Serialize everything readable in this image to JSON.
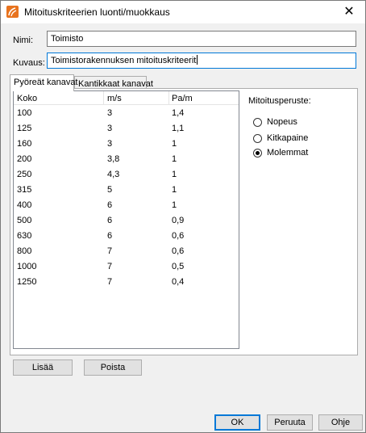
{
  "window": {
    "title": "Mitoituskriteerien luonti/muokkaus",
    "close_glyph": "✕"
  },
  "form": {
    "name_label": "Nimi:",
    "name_value": "Toimisto",
    "description_label": "Kuvaus:",
    "description_value": "Toimistorakennuksen mitoituskriteerit"
  },
  "tabs": [
    {
      "label": "Pyöreät kanavat",
      "active": true
    },
    {
      "label": "Kantikkaat kanavat",
      "active": false
    }
  ],
  "grid": {
    "columns": [
      "Koko",
      "m/s",
      "Pa/m"
    ],
    "rows": [
      [
        "100",
        "3",
        "1,4"
      ],
      [
        "125",
        "3",
        "1,1"
      ],
      [
        "160",
        "3",
        "1"
      ],
      [
        "200",
        "3,8",
        "1"
      ],
      [
        "250",
        "4,3",
        "1"
      ],
      [
        "315",
        "5",
        "1"
      ],
      [
        "400",
        "6",
        "1"
      ],
      [
        "500",
        "6",
        "0,9"
      ],
      [
        "630",
        "6",
        "0,6"
      ],
      [
        "800",
        "7",
        "0,6"
      ],
      [
        "1000",
        "7",
        "0,5"
      ],
      [
        "1250",
        "7",
        "0,4"
      ]
    ]
  },
  "sizing_basis": {
    "label": "Mitoitusperuste:",
    "options": [
      {
        "label": "Nopeus",
        "checked": false
      },
      {
        "label": "Kitkapaine",
        "checked": false
      },
      {
        "label": "Molemmat",
        "checked": true
      }
    ]
  },
  "buttons": {
    "add": "Lisää",
    "remove": "Poista",
    "ok": "OK",
    "cancel": "Peruuta",
    "help": "Ohje"
  },
  "colors": {
    "accent": "#0078d7",
    "icon_orange": "#e8731e"
  },
  "icons": {
    "app": "app-logo-icon",
    "close": "close-icon"
  }
}
